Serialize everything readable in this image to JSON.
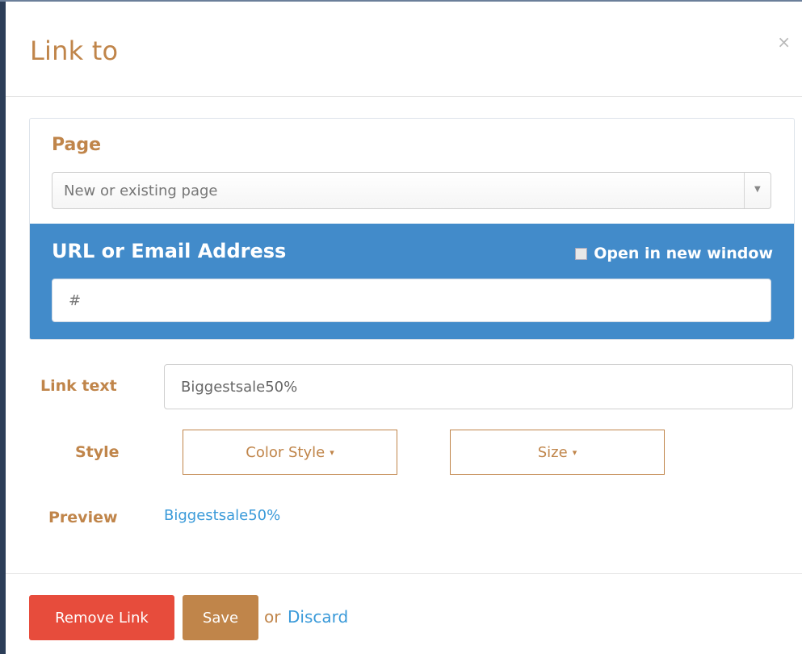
{
  "modal": {
    "title": "Link to",
    "close_glyph": "×"
  },
  "page_section": {
    "label": "Page",
    "select_placeholder": "New or existing page",
    "arrow_glyph": "▼"
  },
  "url_section": {
    "label": "URL or Email Address",
    "new_window_label": "Open in new window",
    "new_window_checked": false,
    "url_value": "#"
  },
  "link_text": {
    "label": "Link text",
    "value": "Biggestsale50%"
  },
  "style": {
    "label": "Style",
    "color_style_label": "Color Style",
    "size_label": "Size",
    "caret_glyph": "▾"
  },
  "preview": {
    "label": "Preview",
    "link_text": "Biggestsale50%"
  },
  "footer": {
    "remove_label": "Remove Link",
    "save_label": "Save",
    "or_text": "or",
    "discard_label": "Discard"
  },
  "colors": {
    "accent": "#c0854a",
    "url_band": "#428bca",
    "remove": "#e74c3c",
    "link": "#3a9ad9"
  }
}
